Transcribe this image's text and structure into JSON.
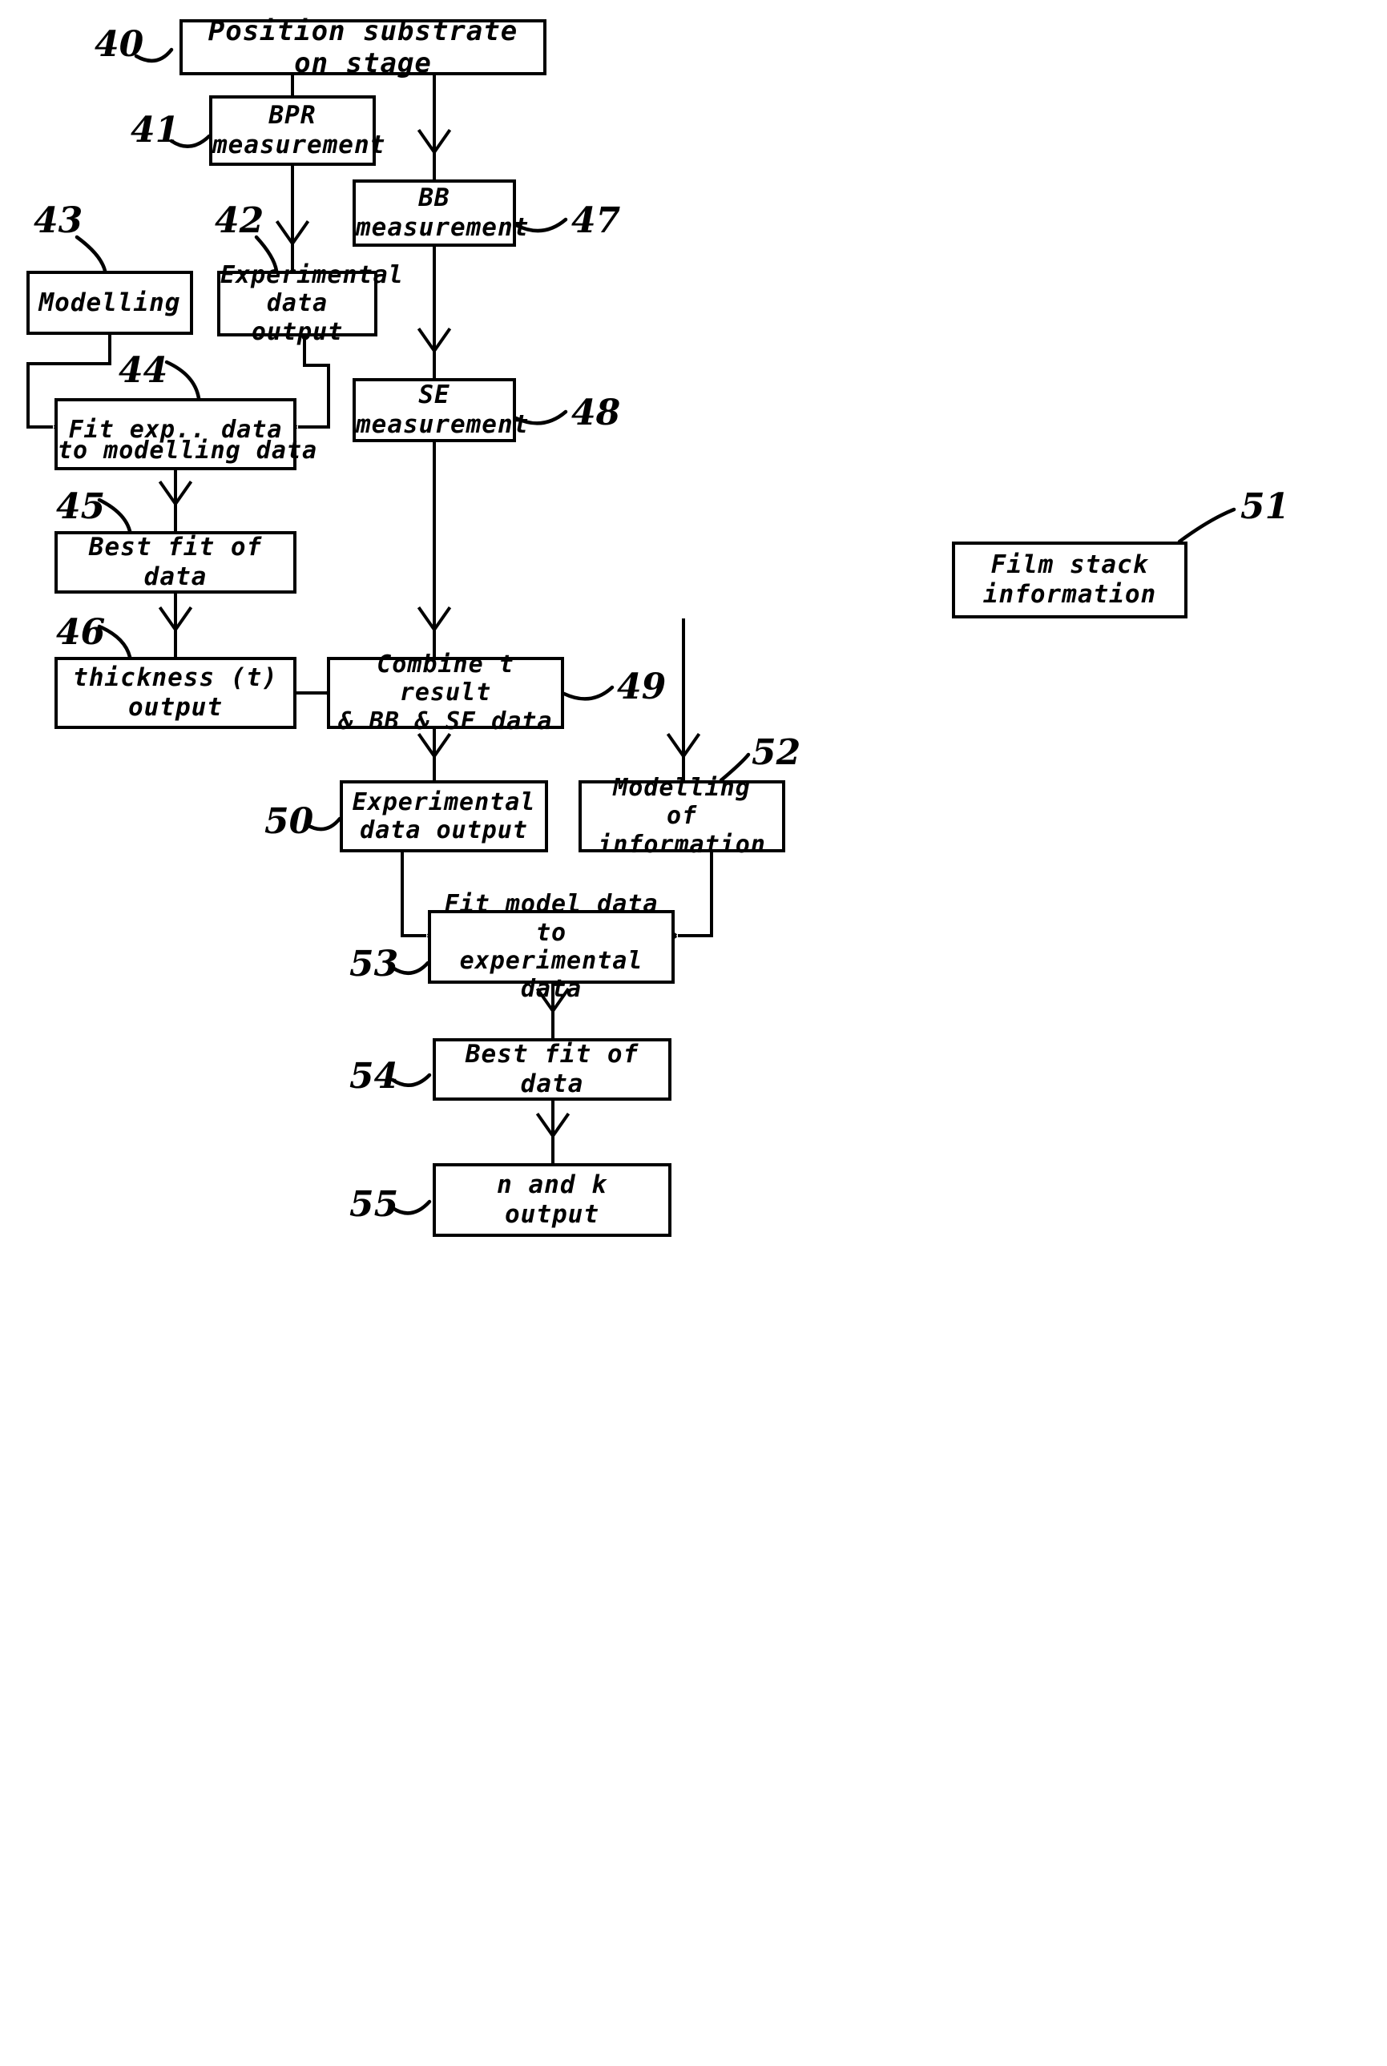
{
  "diagram": {
    "title": "Method flow diagram for combined BPR, BB and SE film measurement",
    "type": "patent-flowchart",
    "ink_color": "#000000",
    "background_color": "#ffffff"
  },
  "nodes": {
    "n40": {
      "ref": "40",
      "text": "Position substrate on stage"
    },
    "n41": {
      "ref": "41",
      "text": "BPR\nmeasurement"
    },
    "n42": {
      "ref": "42",
      "text": "Experimental\ndata output"
    },
    "n43": {
      "ref": "43",
      "text": "Modelling"
    },
    "n44": {
      "ref": "44",
      "line1": "Fit exp.. data",
      "line2": "to modelling data"
    },
    "n45": {
      "ref": "45",
      "text": "Best fit of data"
    },
    "n46": {
      "ref": "46",
      "text": "thickness (t)\noutput"
    },
    "n47": {
      "ref": "47",
      "text": "BB\nmeasurement"
    },
    "n48": {
      "ref": "48",
      "text": "SE\nmeasurement"
    },
    "n49": {
      "ref": "49",
      "text": "Combine t result\n& BB & SE data"
    },
    "n50": {
      "ref": "50",
      "text": "Experimental\ndata output"
    },
    "n51": {
      "ref": "51",
      "text": "Film stack\ninformation"
    },
    "n52": {
      "ref": "52",
      "text": "Modelling\nof information"
    },
    "n53": {
      "ref": "53",
      "text": "Fit model data to\nexperimental data"
    },
    "n54": {
      "ref": "54",
      "text": "Best fit of data"
    },
    "n55": {
      "ref": "55",
      "text": "n and k\noutput"
    }
  },
  "edges": [
    {
      "from": "n40",
      "to": "n41",
      "kind": "arrow-down"
    },
    {
      "from": "n40",
      "to": "n47",
      "kind": "arrow-down"
    },
    {
      "from": "n41",
      "to": "n42",
      "kind": "arrow-down"
    },
    {
      "from": "n43",
      "to": "n44",
      "kind": "arrow-right"
    },
    {
      "from": "n42",
      "to": "n44",
      "kind": "arrow-left"
    },
    {
      "from": "n44",
      "to": "n45",
      "kind": "arrow-down"
    },
    {
      "from": "n45",
      "to": "n46",
      "kind": "arrow-down"
    },
    {
      "from": "n46",
      "to": "n49",
      "kind": "arrow-right"
    },
    {
      "from": "n47",
      "to": "n48",
      "kind": "arrow-down"
    },
    {
      "from": "n48",
      "to": "n49",
      "kind": "arrow-down"
    },
    {
      "from": "n49",
      "to": "n50",
      "kind": "arrow-down"
    },
    {
      "from": "n51",
      "to": "n52",
      "kind": "arrow-down"
    },
    {
      "from": "n50",
      "to": "n53",
      "kind": "arrow-right"
    },
    {
      "from": "n52",
      "to": "n53",
      "kind": "arrow-left"
    },
    {
      "from": "n53",
      "to": "n54",
      "kind": "arrow-down"
    },
    {
      "from": "n54",
      "to": "n55",
      "kind": "arrow-down"
    }
  ]
}
